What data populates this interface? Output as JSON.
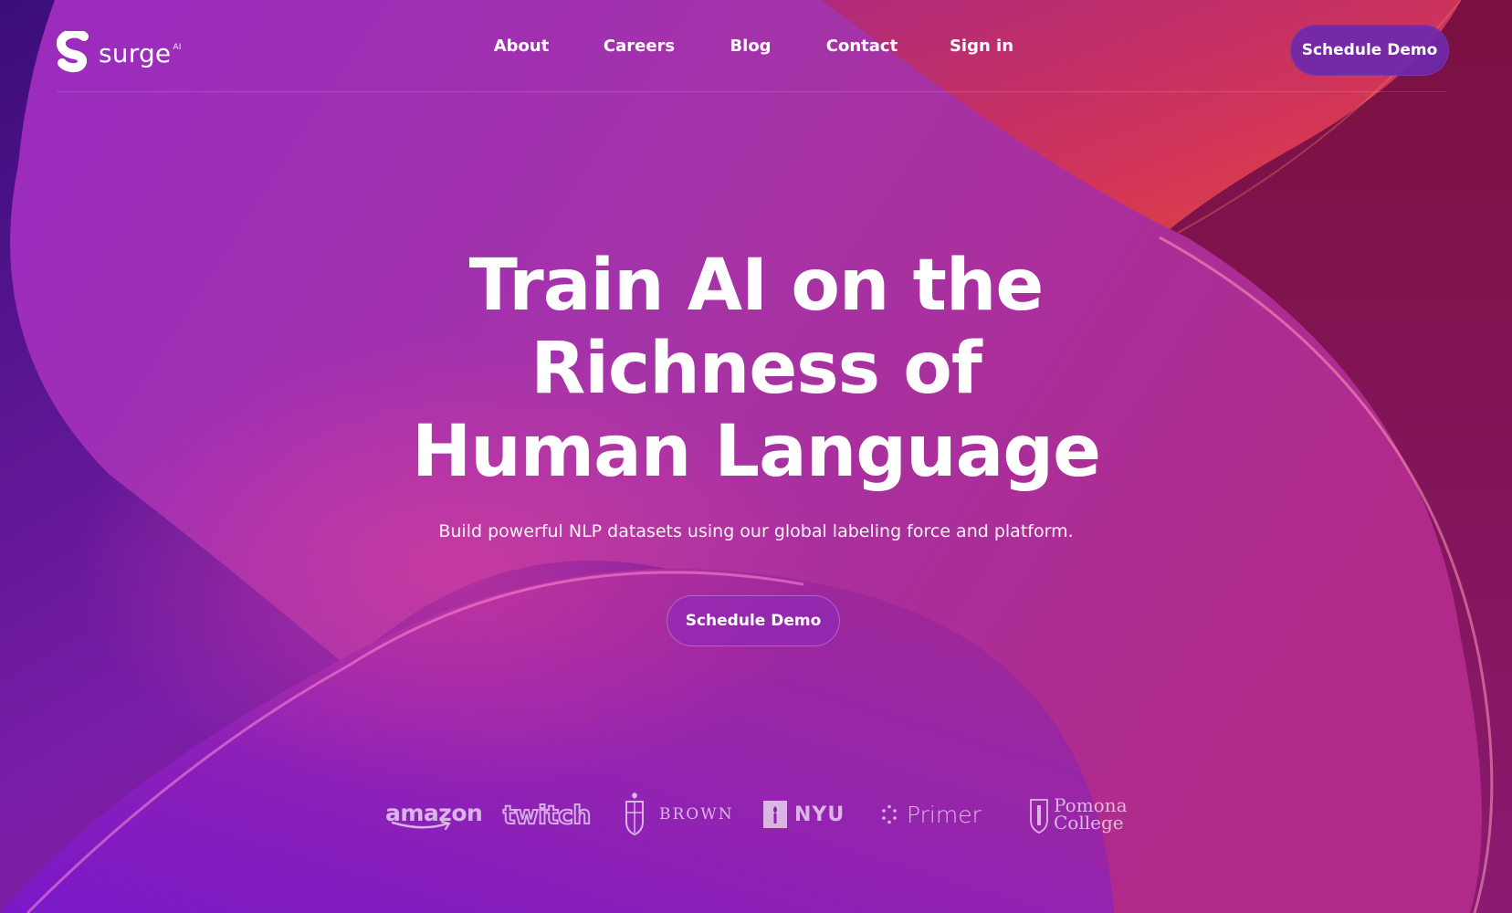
{
  "brand": {
    "name": "surge",
    "superscript": "AI"
  },
  "nav": {
    "links": [
      "About",
      "Careers",
      "Blog",
      "Contact",
      "Sign in"
    ],
    "cta": "Schedule Demo"
  },
  "hero": {
    "title_lines": [
      "Train AI on the",
      "Richness of",
      "Human Language"
    ],
    "subtitle": "Build powerful NLP datasets using our global labeling force and platform.",
    "cta": "Schedule Demo"
  },
  "customers": {
    "amazon": "amazon",
    "twitch": "twitch",
    "brown": "BROWN",
    "nyu": "NYU",
    "primer": "Primer",
    "pomona": [
      "Pomona",
      "College"
    ]
  },
  "colors": {
    "background_base": "#5d1596",
    "ribbon_pink": "#c0308a",
    "ribbon_red": "#e0384a",
    "nav_cta": "#6e28aa"
  }
}
